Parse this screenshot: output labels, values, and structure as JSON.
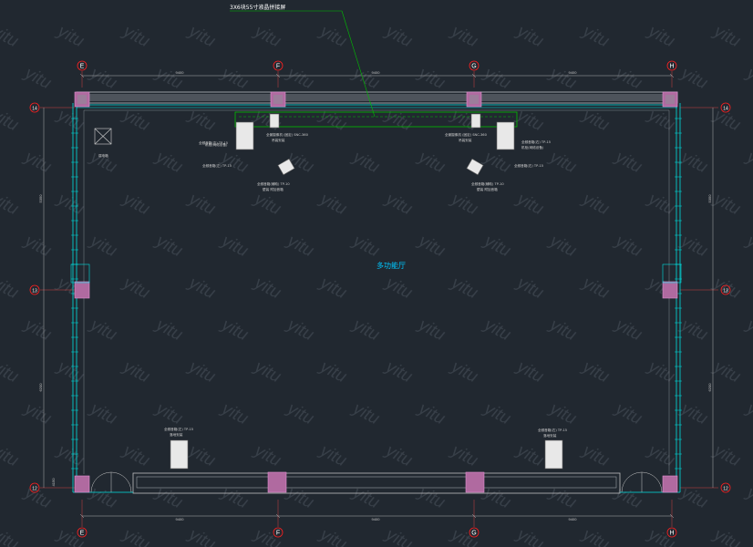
{
  "drawing": {
    "room_label": "多功能厅",
    "callout_label": "3X6块55寸液晶拼接屏",
    "watermark_text": "yitu",
    "column_axes": [
      "E",
      "F",
      "G",
      "H"
    ],
    "row_axes": [
      "14",
      "13",
      "12"
    ],
    "dims_top": [
      "9400",
      "9400",
      "9400"
    ],
    "dims_bottom": [
      "9400",
      "9400",
      "9400"
    ],
    "dims_left": [
      "5350",
      "6200",
      "4150"
    ],
    "dims_right": [
      "5350",
      "6200"
    ],
    "equipment_notes": [
      "全频音箱(左) TP-15",
      "全频音箱(左) TP-15",
      "全频音箱(右) TP-15",
      "全频音箱(右) TP-15",
      "全景摄像机 (固定) SNC-360",
      "吊装安装",
      "全景摄像机 (固定) SNC-360",
      "吊装安装",
      "全频音箱(辅助) TP-10",
      "壁装 附加音箱",
      "全频音箱(辅助) TP-10",
      "壁装 附加音箱",
      "全频音箱(左) TP-15",
      "落地安装",
      "全频音箱(右) TP-15",
      "落地安装",
      "弱电箱",
      "机柜(网络设备)",
      "机柜(网络设备)"
    ]
  },
  "colors": {
    "background": "#212830",
    "wall": "#9aa0a6",
    "column": "#b06aa0",
    "cyan": "#00e0e0",
    "green": "#00c000",
    "axis_bubble": "#ff2020"
  }
}
